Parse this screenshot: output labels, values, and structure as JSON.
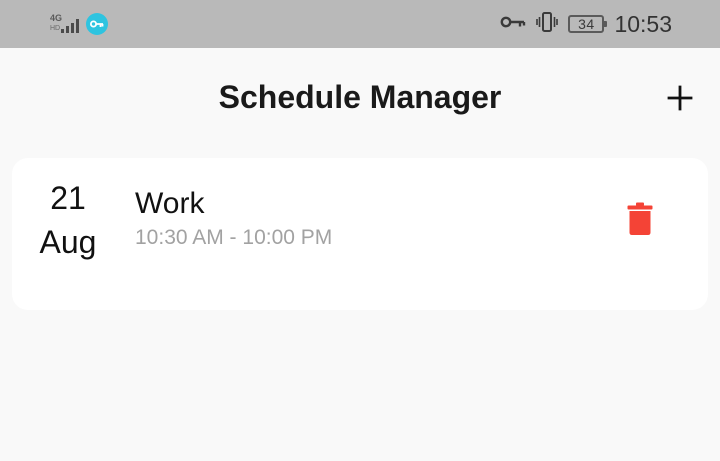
{
  "status_bar": {
    "network_type": "4G",
    "network_sub": "HD",
    "battery_level": "34",
    "time": "10:53",
    "icons": [
      "signal-icon",
      "vpn-icon",
      "key-icon",
      "vibrate-icon",
      "battery-icon"
    ]
  },
  "header": {
    "title": "Schedule Manager",
    "add_icon": "plus-icon"
  },
  "schedules": [
    {
      "day": "21",
      "month": "Aug",
      "title": "Work",
      "time_range": "10:30 AM - 10:00 PM",
      "delete_icon": "trash-icon"
    }
  ],
  "colors": {
    "status_bar_bg": "#b9b9b9",
    "page_bg": "#f9f9f9",
    "card_bg": "#ffffff",
    "delete_red": "#f44336",
    "vpn_badge": "#2ec4e0",
    "muted_text": "#a2a2a2"
  }
}
